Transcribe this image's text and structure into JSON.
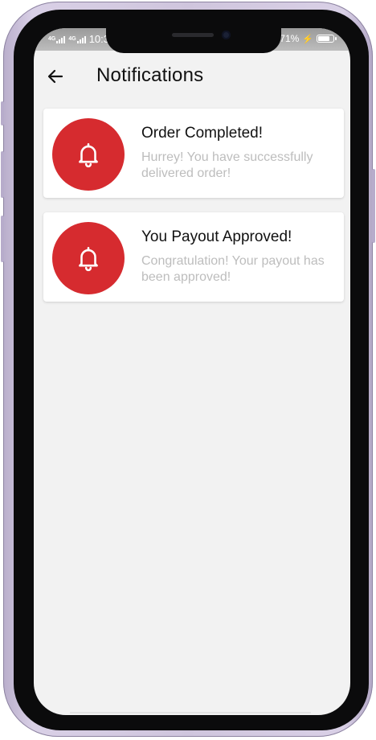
{
  "status_bar": {
    "network_left": "4G",
    "network_left_2": "4G",
    "time": "10:3",
    "battery": "71%",
    "battery_level": 0.71
  },
  "header": {
    "back_icon": "arrow-left-icon",
    "title": "Notifications"
  },
  "notifications": [
    {
      "icon": "bell-icon",
      "title": "Order Completed!",
      "message": "Hurrey! You have successfully delivered order!"
    },
    {
      "icon": "bell-icon",
      "title": "You Payout Approved!",
      "message": "Congratulation! Your payout has been approved!"
    }
  ],
  "colors": {
    "accent": "#d62b2f",
    "screen_background": "#f2f2f2",
    "card_background": "#ffffff",
    "title_text": "#111111",
    "message_text": "#bdbdbd",
    "phone_frame": "#cfc5dd"
  }
}
